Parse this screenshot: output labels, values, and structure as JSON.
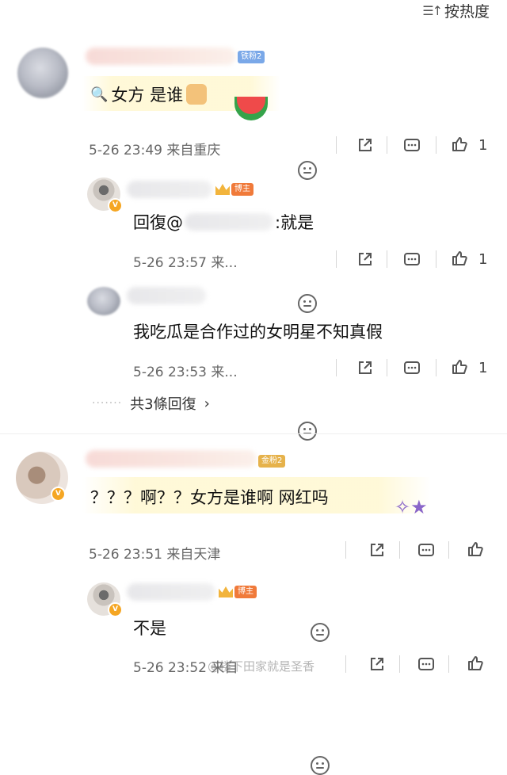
{
  "sort_label": "按热度",
  "comments": [
    {
      "text": "女方 是谁",
      "tag": "铁粉2",
      "time": "5-26 23:49",
      "location": "来自重庆",
      "likes": "1"
    },
    {
      "tag": "博主",
      "text": "回復@",
      "text_suffix": ":就是",
      "time": "5-26 23:57",
      "location": "来...",
      "likes": "1"
    },
    {
      "text": "我吃瓜是合作过的女明星不知真假",
      "time": "5-26 23:53",
      "location": "来...",
      "likes": "1"
    },
    {
      "more_replies": "共3條回復"
    },
    {
      "tag": "金粉2",
      "text": "？？？啊？？女方是谁啊 网红吗",
      "time": "5-26 23:51",
      "location": "来自天津"
    },
    {
      "tag": "博主",
      "text": "不是",
      "time": "5-26 23:52",
      "location": "来自"
    }
  ],
  "watermark": "@楼下田家就是圣香"
}
